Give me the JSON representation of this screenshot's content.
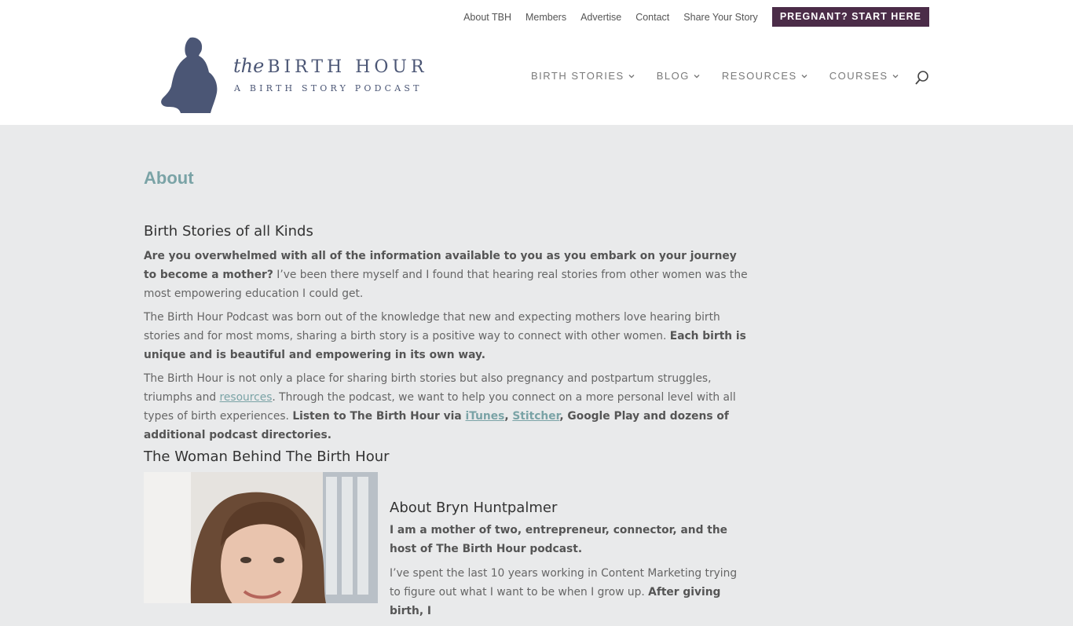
{
  "top_menu": {
    "items": [
      "About TBH",
      "Members",
      "Advertise",
      "Contact",
      "Share Your Story"
    ],
    "cta": "PREGNANT? START HERE"
  },
  "logo": {
    "the": "the",
    "title": "BIRTH HOUR",
    "subtitle": "A BIRTH STORY PODCAST"
  },
  "main_nav": {
    "items": [
      "BIRTH STORIES",
      "BLOG",
      "RESOURCES",
      "COURSES"
    ]
  },
  "page": {
    "title": "About",
    "section1_heading": "Birth Stories of all Kinds",
    "p1_bold": "Are you overwhelmed with all of the information available to you as you embark on your journey to become a mother?",
    "p1_rest": " I’ve been there myself and I found that hearing real stories from other women was the most empowering education I could get.",
    "p2_text": "The Birth Hour Podcast was born out of the knowledge that new and expecting mothers love hearing birth stories and for most moms, sharing a birth story is a positive way to connect with other women. ",
    "p2_bold": "Each birth is unique and is beautiful and empowering in its own way.",
    "p3_a": "The Birth Hour is not only a place for sharing birth stories but also pregnancy and postpartum struggles, triumphs and ",
    "p3_link_resources": "resources",
    "p3_b": ". Through the podcast, we want to help you connect on a more personal level with all types of birth experiences. ",
    "p3_bold_a": "Listen to The Birth Hour via ",
    "p3_link_itunes": "iTunes",
    "p3_comma": ", ",
    "p3_link_stitcher": "Stitcher",
    "p3_bold_b": ", Google Play and dozens of additional podcast directories.",
    "section2_heading": "The Woman Behind The Birth Hour"
  },
  "bio": {
    "heading": "About Bryn Huntpalmer",
    "p1_bold": "I am a mother of two, entrepreneur, connector, and the host of The Birth Hour podcast.",
    "p2_text": "I’ve spent the last 10 years working in Content Marketing trying to figure out what I want to be when I grow up. ",
    "p2_bold": "After giving birth, I"
  },
  "colors": {
    "accent": "#7aa3a6",
    "cta_bg": "#4b2c48",
    "logo": "#4b5675",
    "page_bg": "#e9eaeb"
  }
}
